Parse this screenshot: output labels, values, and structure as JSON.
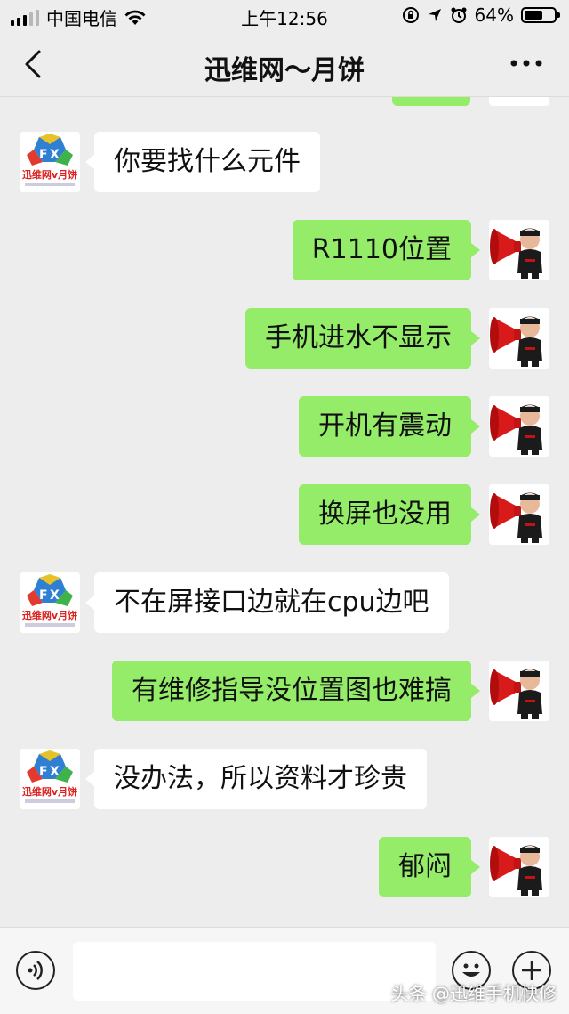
{
  "status_bar": {
    "carrier": "中国电信",
    "time": "上午12:56",
    "battery": "64%",
    "battery_level": 0.64,
    "icons": [
      "signal-icon",
      "wifi-icon",
      "orientation-lock-icon",
      "location-icon",
      "alarm-icon",
      "battery-icon"
    ]
  },
  "nav": {
    "title": "迅维网～月饼",
    "back_icon": "chevron-left-icon",
    "more_icon": "more-dots-icon"
  },
  "left_avatar_text": "迅维网v月饼",
  "messages": [
    {
      "side": "left",
      "text": "你要找什么元件"
    },
    {
      "side": "right",
      "text": "R1110位置"
    },
    {
      "side": "right",
      "text": "手机进水不显示"
    },
    {
      "side": "right",
      "text": "开机有震动"
    },
    {
      "side": "right",
      "text": "换屏也没用"
    },
    {
      "side": "left",
      "text": "不在屏接口边就在cpu边吧"
    },
    {
      "side": "right",
      "text": "有维修指导没位置图也难搞"
    },
    {
      "side": "left",
      "text": "没办法，所以资料才珍贵"
    },
    {
      "side": "right",
      "text": "郁闷"
    }
  ],
  "input_bar": {
    "placeholder": "",
    "icons": [
      "voice-icon",
      "emoji-icon",
      "plus-icon"
    ]
  },
  "watermark": "头条 @迅维手机快修",
  "colors": {
    "sent_bubble": "#95ec69",
    "received_bubble": "#ffffff",
    "background": "#ededed"
  }
}
